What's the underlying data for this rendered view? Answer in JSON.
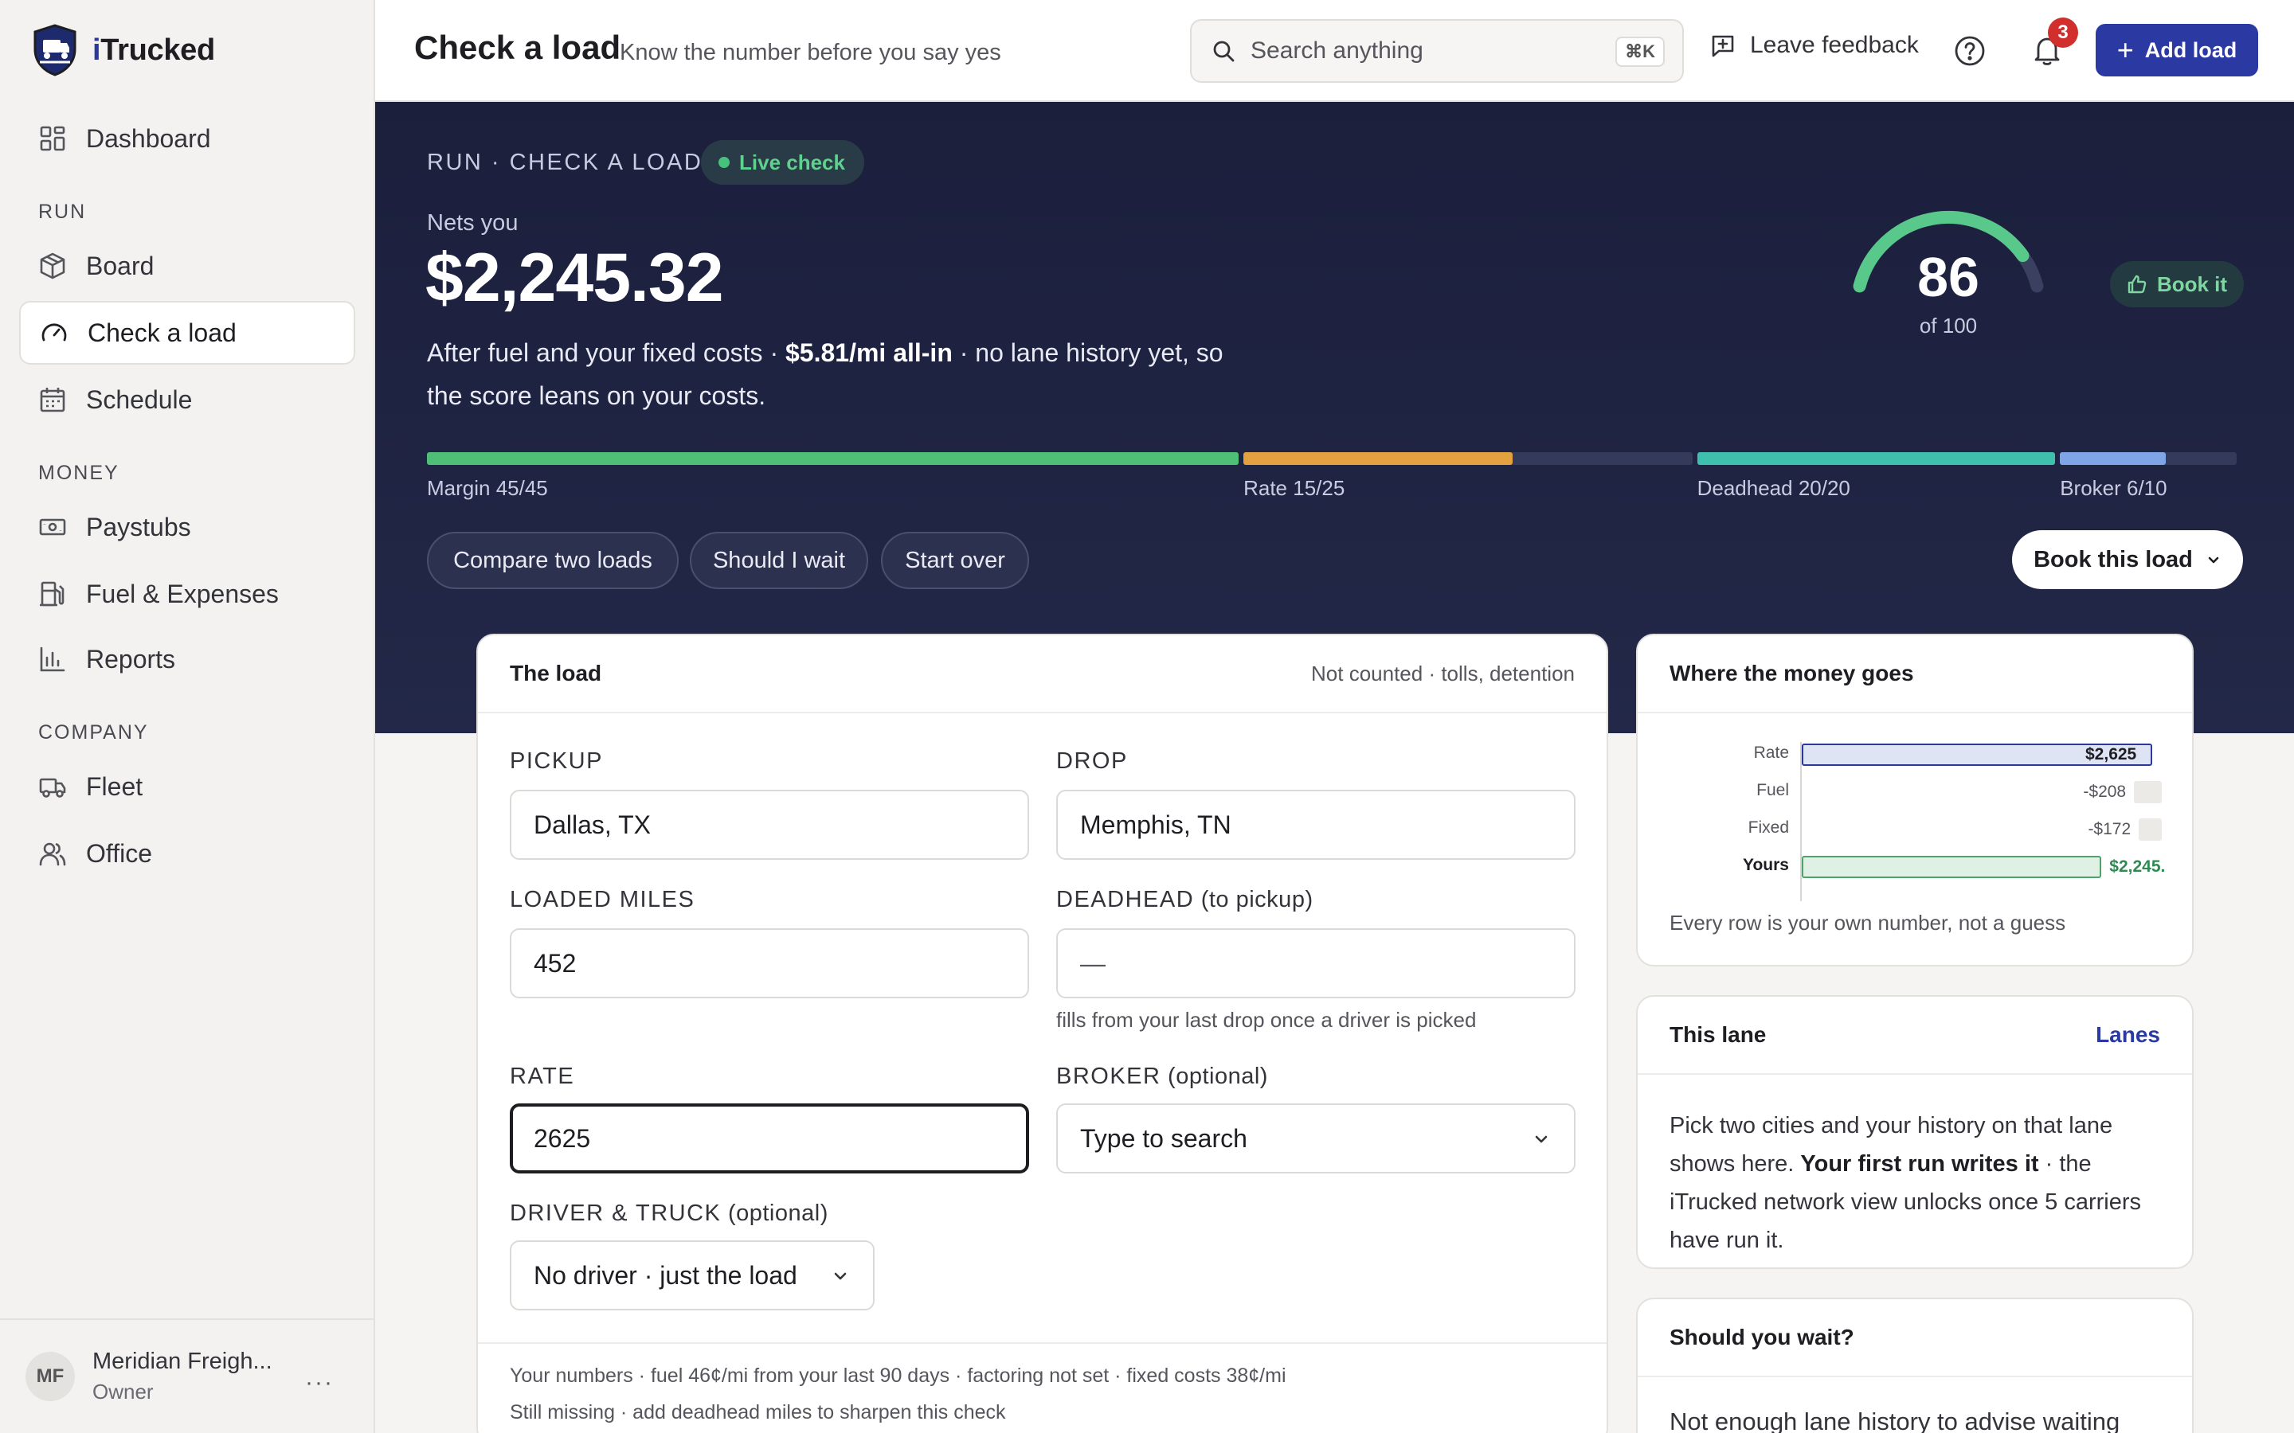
{
  "app": {
    "brand_prefix": "i",
    "brand_rest": "Trucked",
    "account_name": "Meridian Freigh...",
    "account_role": "Owner",
    "account_initials": "MF"
  },
  "sidebar": {
    "dashboard": "Dashboard",
    "sections": {
      "run": "RUN",
      "money": "MONEY",
      "company": "COMPANY"
    },
    "items": {
      "board": "Board",
      "check_load": "Check a load",
      "schedule": "Schedule",
      "paystubs": "Paystubs",
      "fuel": "Fuel & Expenses",
      "reports": "Reports",
      "fleet": "Fleet",
      "office": "Office"
    },
    "more": "···"
  },
  "topbar": {
    "title": "Check a load",
    "subtitle": "Know the number before you say yes",
    "search_placeholder": "Search anything",
    "search_shortcut": "⌘K",
    "feedback": "Leave feedback",
    "notification_count": "3",
    "add_load": "Add load"
  },
  "hero": {
    "breadcrumb": "RUN · CHECK A LOAD",
    "live_label": "Live check",
    "nets_label": "Nets you",
    "nets_value": "$2,245.32",
    "desc_pre": "After fuel and your fixed costs · ",
    "desc_bold": "$5.81/mi all-in",
    "desc_post": " · no lane history yet, so the score leans on your costs.",
    "score": 86,
    "score_max": 100,
    "score_of": "of 100",
    "book_it": "Book it",
    "breakdown": [
      {
        "label": "Margin 45/45",
        "score": 45,
        "max": 45,
        "color": "#4fbf78"
      },
      {
        "label": "Rate 15/25",
        "score": 15,
        "max": 25,
        "color": "#e3a23f"
      },
      {
        "label": "Deadhead 20/20",
        "score": 20,
        "max": 20,
        "color": "#3fbfae"
      },
      {
        "label": "Broker 6/10",
        "score": 6,
        "max": 10,
        "color": "#7ea6e6"
      }
    ],
    "actions": {
      "compare": "Compare two loads",
      "wait": "Should I wait",
      "start_over": "Start over"
    },
    "book_load": "Book this load"
  },
  "load_card": {
    "title": "The load",
    "note": "Not counted · tolls, detention",
    "pickup_label": "PICKUP",
    "pickup_value": "Dallas, TX",
    "drop_label": "DROP",
    "drop_value": "Memphis, TN",
    "miles_label": "LOADED MILES",
    "miles_value": "452",
    "deadhead_label": "DEADHEAD",
    "deadhead_opt": " (to pickup)",
    "deadhead_value": "—",
    "deadhead_help": "fills from your last drop once a driver is picked",
    "rate_label": "RATE",
    "rate_value": "2625",
    "broker_label": "BROKER",
    "broker_opt": " (optional)",
    "broker_placeholder": "Type to search",
    "driver_label": "DRIVER & TRUCK",
    "driver_opt": " (optional)",
    "driver_value": "No driver · just the load",
    "footer_1": "Your numbers  · fuel 46¢/mi from your last 90 days  · factoring not set  · fixed costs 38¢/mi",
    "footer_2": "Still missing · add deadhead miles to sharpen this check"
  },
  "money_card": {
    "title": "Where the money goes",
    "rows": [
      {
        "label": "Rate",
        "value": 2625,
        "display": "$2,625"
      },
      {
        "label": "Fuel",
        "value": -208,
        "display": "-$208"
      },
      {
        "label": "Fixed",
        "value": -172,
        "display": "-$172"
      },
      {
        "label": "Yours",
        "value": 2245,
        "display": "$2,245."
      }
    ],
    "note": "Every row is your own number, not a guess"
  },
  "lane_card": {
    "title": "This lane",
    "link": "Lanes",
    "text_pre": "Pick two cities and your history on that lane shows here. ",
    "text_bold": "Your first run writes it",
    "text_post": " · the iTrucked network view unlocks once 5 carriers have run it."
  },
  "wait_card": {
    "title": "Should you wait?",
    "text": "Not enough lane history to advise waiting"
  }
}
